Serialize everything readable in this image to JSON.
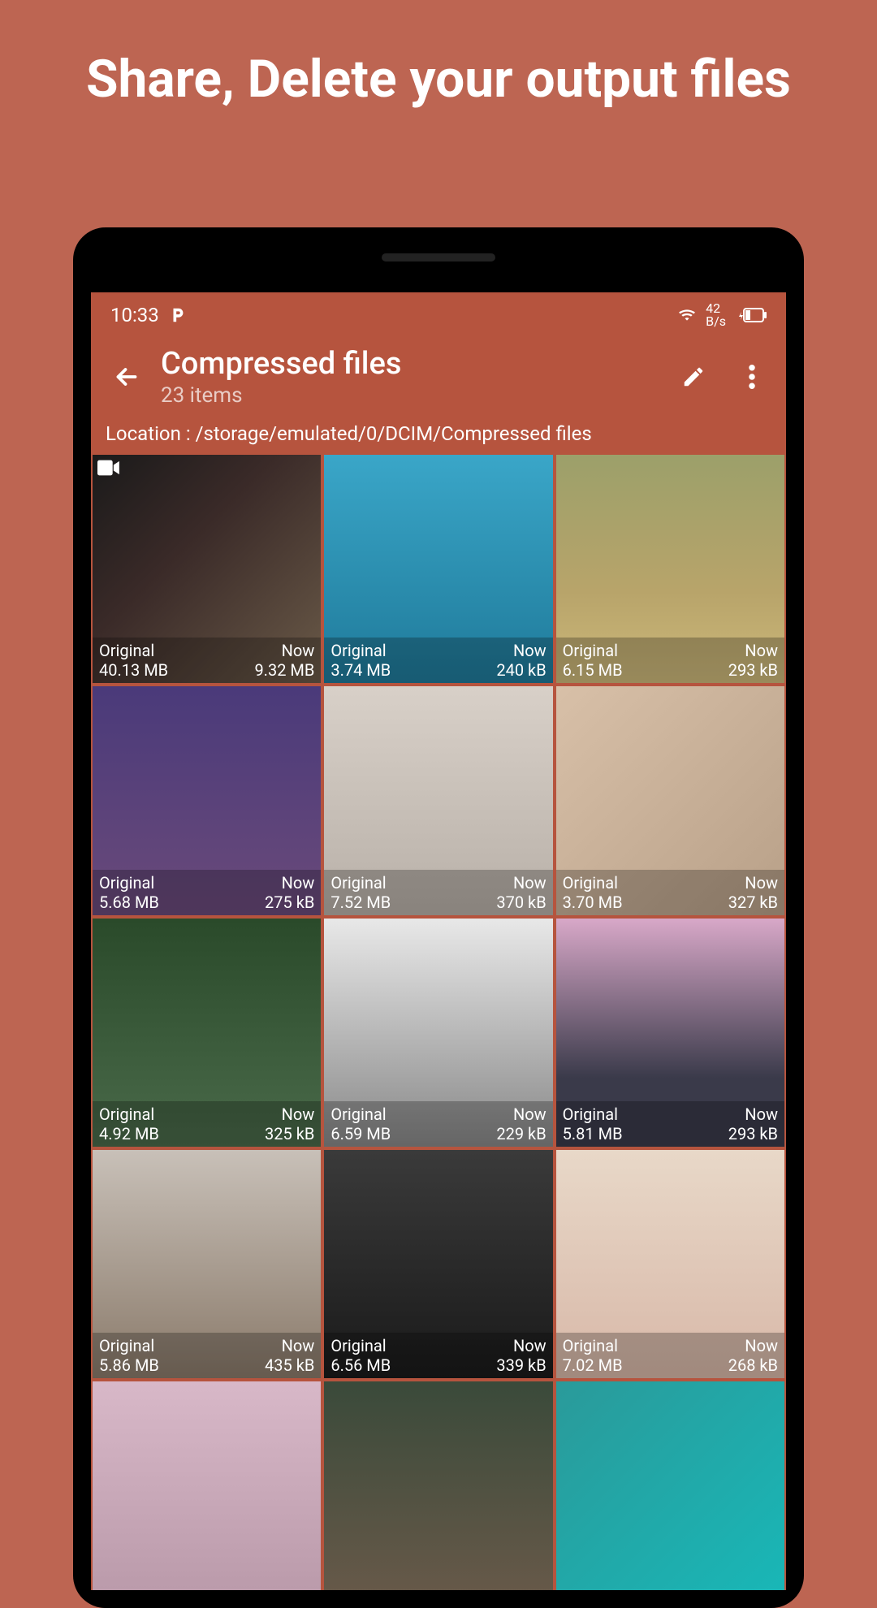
{
  "promo": {
    "title": "Share, Delete your output files"
  },
  "status": {
    "time": "10:33",
    "net_rate_top": "42",
    "net_rate_unit": "B/s"
  },
  "header": {
    "title": "Compressed files",
    "subtitle": "23 items",
    "location_label": "Location : ",
    "location_path": "/storage/emulated/0/DCIM/Compressed files"
  },
  "labels": {
    "original": "Original",
    "now": "Now"
  },
  "items": [
    {
      "original": "40.13 MB",
      "now": "9.32 MB",
      "video": true,
      "bg": "linear-gradient(135deg,#1a1a1a,#3a2a28 40%,#6a5a48)"
    },
    {
      "original": "3.74 MB",
      "now": "240 kB",
      "video": false,
      "bg": "linear-gradient(180deg,#3aa6c8,#1f7a9a)"
    },
    {
      "original": "6.15 MB",
      "now": "293 kB",
      "video": false,
      "bg": "linear-gradient(180deg,#9ca06a,#b8a46a 60%,#ccb87a)"
    },
    {
      "original": "5.68 MB",
      "now": "275 kB",
      "video": false,
      "bg": "linear-gradient(180deg,#4a3a7a,#6a4a7a)"
    },
    {
      "original": "7.52 MB",
      "now": "370 kB",
      "video": false,
      "bg": "linear-gradient(180deg,#d8d0c8,#b8b0a8)"
    },
    {
      "original": "3.70 MB",
      "now": "327 kB",
      "video": false,
      "bg": "linear-gradient(135deg,#d8c0a8,#b8a088)"
    },
    {
      "original": "4.92 MB",
      "now": "325 kB",
      "video": false,
      "bg": "linear-gradient(180deg,#2a4a2a,#4a6a4a)"
    },
    {
      "original": "6.59 MB",
      "now": "229 kB",
      "video": false,
      "bg": "linear-gradient(180deg,#e8e8e8,#888888)"
    },
    {
      "original": "5.81 MB",
      "now": "293 kB",
      "video": false,
      "bg": "linear-gradient(180deg,#d8a8c8,#3a3a4a 70%)"
    },
    {
      "original": "5.86 MB",
      "now": "435 kB",
      "video": false,
      "bg": "linear-gradient(180deg,#c8c0b8,#8a7a6a)"
    },
    {
      "original": "6.56 MB",
      "now": "339 kB",
      "video": false,
      "bg": "linear-gradient(180deg,#3a3a3a,#1a1a1a)"
    },
    {
      "original": "7.02 MB",
      "now": "268 kB",
      "video": false,
      "bg": "linear-gradient(180deg,#e8d8c8,#d8b8a8)"
    },
    {
      "original": "",
      "now": "",
      "video": false,
      "bg": "linear-gradient(180deg,#d8b8c8,#b898a8)",
      "partial": true
    },
    {
      "original": "",
      "now": "",
      "video": false,
      "bg": "linear-gradient(180deg,#3a4a3a,#6a5a4a)",
      "partial": true
    },
    {
      "original": "",
      "now": "",
      "video": false,
      "bg": "linear-gradient(135deg,#2a9a9a,#18b8b8)",
      "partial": true
    }
  ]
}
